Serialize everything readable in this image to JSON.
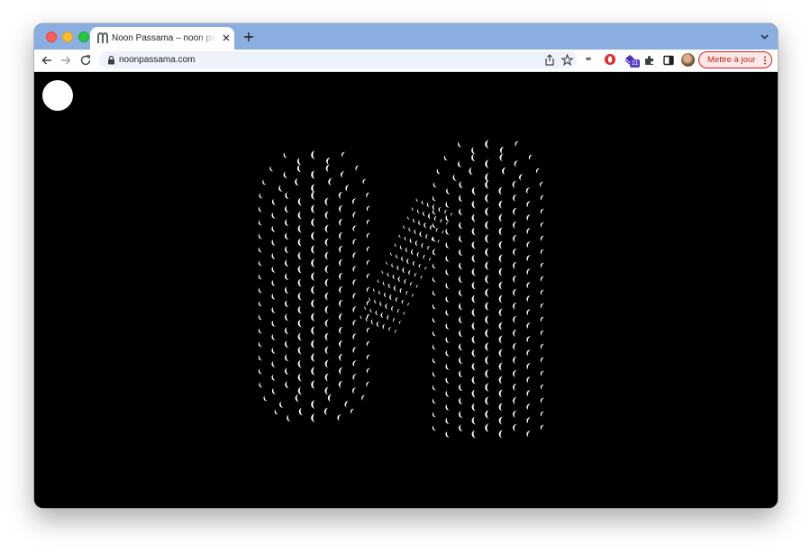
{
  "browser": {
    "tab_title": "Noon Passama – noon passama",
    "url": "noonpassama.com",
    "update_button_label": "Mettre à jour",
    "extension_badge": "11",
    "extension_text": "**"
  },
  "colors": {
    "tabstrip": "#8aaee0",
    "page_background": "#000000",
    "logo_marks": "#ffffff",
    "update_button": "#c5221f"
  },
  "icons": [
    "back-icon",
    "forward-icon",
    "reload-icon",
    "lock-icon",
    "share-icon",
    "star-icon",
    "opera-icon",
    "extension-icon",
    "puzzle-icon",
    "side-panel-icon",
    "avatar",
    "kebab-menu-icon",
    "close-icon",
    "plus-icon",
    "chevron-down-icon"
  ],
  "page": {
    "menu_button": "menu-dot",
    "logo": "noon-passama-logo"
  }
}
